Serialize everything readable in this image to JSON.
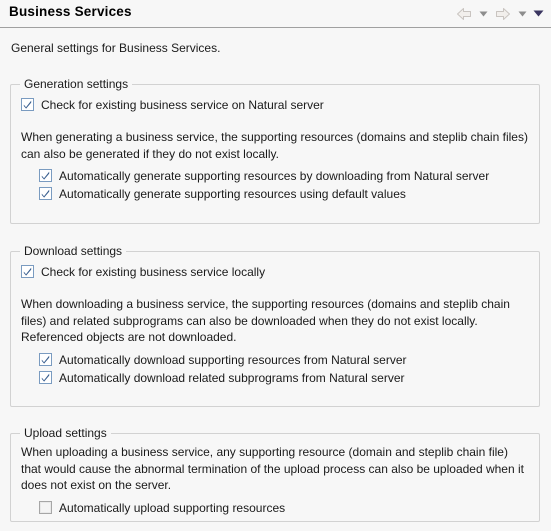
{
  "header": {
    "title": "Business Services",
    "nav": [
      {
        "name": "back-arrow-icon",
        "kind": "arrow-left",
        "enabled": false
      },
      {
        "name": "back-dropdown-icon",
        "kind": "caret-down-gray",
        "enabled": true
      },
      {
        "name": "forward-arrow-icon",
        "kind": "arrow-right",
        "enabled": false
      },
      {
        "name": "forward-dropdown-icon",
        "kind": "caret-down-gray",
        "enabled": true
      },
      {
        "name": "view-menu-icon",
        "kind": "caret-down-dark",
        "enabled": true
      }
    ]
  },
  "intro": {
    "text": "General settings for Business Services."
  },
  "groups": [
    {
      "title": "Generation settings",
      "primary_checkbox": {
        "label": "Check for existing business service on Natural server",
        "checked": true
      },
      "description": "When generating a business service, the supporting resources (domains and steplib chain files) can also be generated if they do not exist locally.",
      "sub_checkboxes": [
        {
          "label": "Automatically generate supporting resources by downloading from Natural server",
          "checked": true
        },
        {
          "label": "Automatically generate supporting resources using default values",
          "checked": true
        }
      ]
    },
    {
      "title": "Download settings",
      "primary_checkbox": {
        "label": "Check for existing business service locally",
        "checked": true
      },
      "description": "When downloading a business service, the supporting resources (domains and steplib chain files) and related subprograms can also be downloaded when they do not exist locally. Referenced objects are not downloaded.",
      "sub_checkboxes": [
        {
          "label": "Automatically download supporting resources from Natural server",
          "checked": true
        },
        {
          "label": "Automatically download related subprograms from Natural server",
          "checked": true
        }
      ]
    },
    {
      "title": "Upload settings",
      "description": "When uploading a business service, any supporting resource (domain and steplib chain file) that would cause the abnormal termination of the upload process can also be uploaded when it does not exist on the server.",
      "sub_checkboxes": [
        {
          "label": "Automatically upload supporting resources",
          "checked": false
        }
      ]
    }
  ],
  "colors": {
    "background": "#f7f7f7",
    "text": "#1a1a1a",
    "group_border": "#d2d2d2",
    "header_rule": "#a0a0a0",
    "checkbox_checked_border": "#7a9bc0",
    "checkbox_check": "#3a5f8f",
    "checkbox_unchecked_border": "#a6a6a6",
    "arrow_disabled": "#cfcbc8",
    "caret_gray": "#8d8d8d",
    "caret_dark": "#3a3560"
  }
}
